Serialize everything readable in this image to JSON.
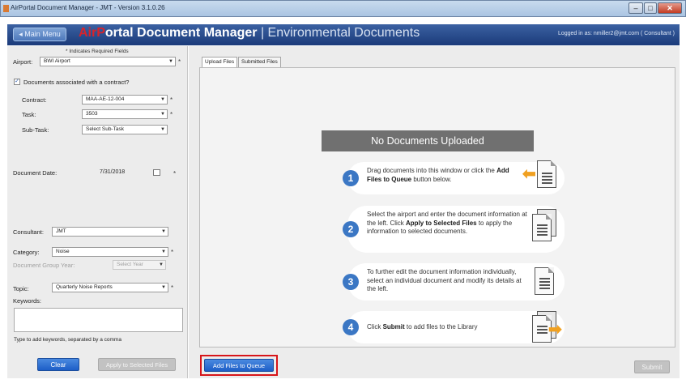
{
  "window": {
    "title": "AirPortal Document Manager - JMT - Version 3.1.0.26"
  },
  "header": {
    "main_menu": "◂ Main Menu",
    "brand_air": "AirP",
    "brand_rest": "ortal Document Manager",
    "brand_sep": " | ",
    "brand_section": "Environmental Documents",
    "login": "Logged in as: nmiller2@jmt.com ( Consultant )"
  },
  "form": {
    "required_note": "* Indicates Required Fields",
    "airport": {
      "label": "Airport:",
      "value": "BWI Airport"
    },
    "contract_check": {
      "label": "Documents associated with a contract?",
      "checked": true
    },
    "contract": {
      "label": "Contract:",
      "value": "MAA-AE-12-004"
    },
    "task": {
      "label": "Task:",
      "value": "3503"
    },
    "subtask": {
      "label": "Sub-Task:",
      "value": "Select Sub-Task"
    },
    "document_date": {
      "label": "Document Date:",
      "value": "7/31/2018"
    },
    "consultant": {
      "label": "Consultant:",
      "value": "JMT"
    },
    "category": {
      "label": "Category:",
      "value": "Noise"
    },
    "doc_group_year": {
      "label": "Document Group Year:",
      "value": "Select Year"
    },
    "topic": {
      "label": "Topic:",
      "value": "Quarterly Noise Reports"
    },
    "keywords": {
      "label": "Keywords:",
      "hint": "Type to add keywords, separated by a comma",
      "value": ""
    },
    "asterisk": "*",
    "clear_button": "Clear",
    "apply_button": "Apply to Selected Files"
  },
  "tabs": [
    {
      "label": "Upload Files",
      "active": true
    },
    {
      "label": "Submitted Files",
      "active": false
    }
  ],
  "upload": {
    "empty_title": "No Documents Uploaded",
    "steps": [
      {
        "num": "1",
        "pre": "Drag documents into this window or click the ",
        "bold": "Add Files to Queue",
        "post": " button below."
      },
      {
        "num": "2",
        "pre": "Select the airport and enter the document information at the left. Click ",
        "bold": "Apply to Selected Files",
        "post": " to apply the information to selected documents."
      },
      {
        "num": "3",
        "pre": "To further edit the document information individually, select an individual document and modify its details at the left.",
        "bold": "",
        "post": ""
      },
      {
        "num": "4",
        "pre": "Click ",
        "bold": "Submit",
        "post": " to add files to the Library"
      }
    ],
    "add_files_button": "Add Files to Queue",
    "submit_button": "Submit"
  },
  "colors": {
    "header": "#1b3b7a",
    "accent_blue": "#3b77c4",
    "highlight_red": "#d7151a",
    "brand_red": "#d8232a"
  }
}
